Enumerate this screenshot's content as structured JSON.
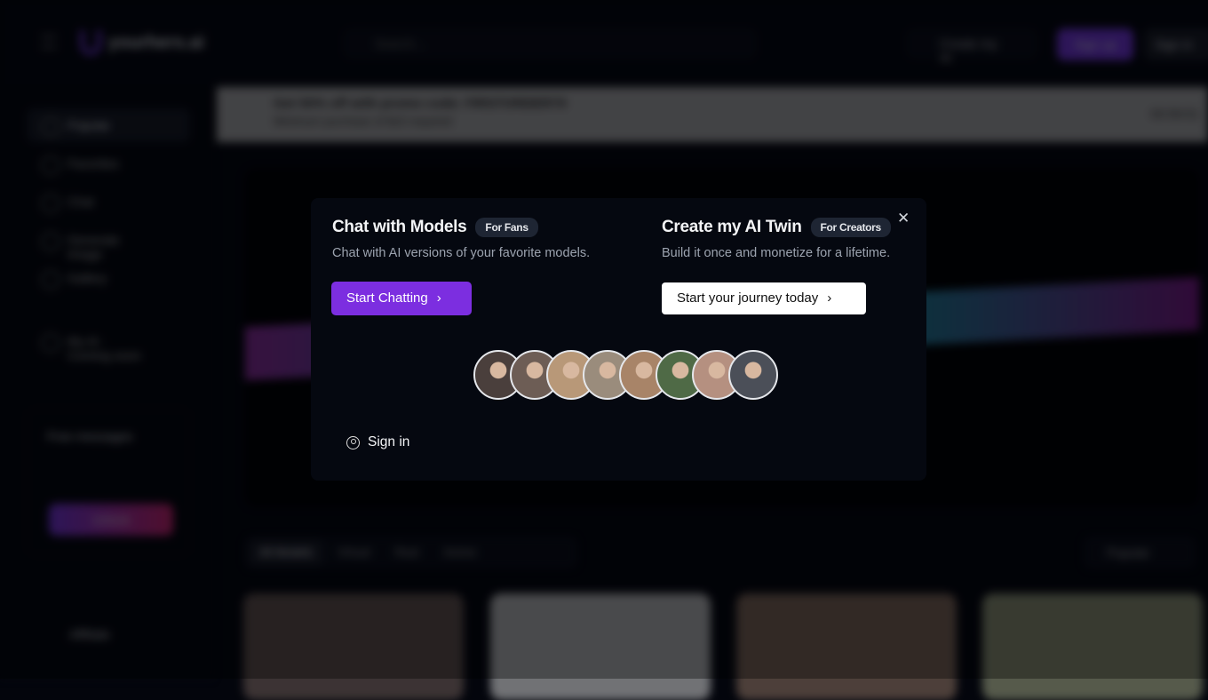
{
  "header": {
    "brand": "yourhers.ai",
    "search_placeholder": "Search...",
    "create_label": "Create my AI",
    "signup_label": "Sign up",
    "signin_label": "Sign in"
  },
  "promo": {
    "title": "Get 50% off with promo code: FIRSTORDER70",
    "subtitle": "Minimum purchase of $10 required",
    "timer": "00:59:51"
  },
  "sidebar": {
    "items": [
      {
        "label": "Popular"
      },
      {
        "label": "Favorites"
      },
      {
        "label": "Chat"
      },
      {
        "label": "Generate Image"
      },
      {
        "label": "Gallery"
      }
    ],
    "my_ai": "My AI · Coming soon",
    "free_messages": "Free messages",
    "unlock": "Unlock",
    "affiliate": "Affiliate"
  },
  "filters": {
    "tabs": [
      "All Models",
      "Virtual",
      "Real",
      "Anime"
    ],
    "sort": "Popular"
  },
  "modal": {
    "fans": {
      "title": "Chat with Models",
      "badge": "For Fans",
      "subtitle": "Chat with AI versions of your favorite models.",
      "button": "Start Chatting"
    },
    "creators": {
      "title": "Create my AI Twin",
      "badge": "For Creators",
      "subtitle": "Build it once and monetize for a lifetime.",
      "button": "Start your journey today"
    },
    "sign_in": "Sign in",
    "avatar_colors": [
      "#4a3f3c",
      "#6d5d55",
      "#b89878",
      "#9a8c7c",
      "#a88468",
      "#4f6a46",
      "#b59080",
      "#4b4f58"
    ],
    "accent": "#7c2ee0"
  }
}
